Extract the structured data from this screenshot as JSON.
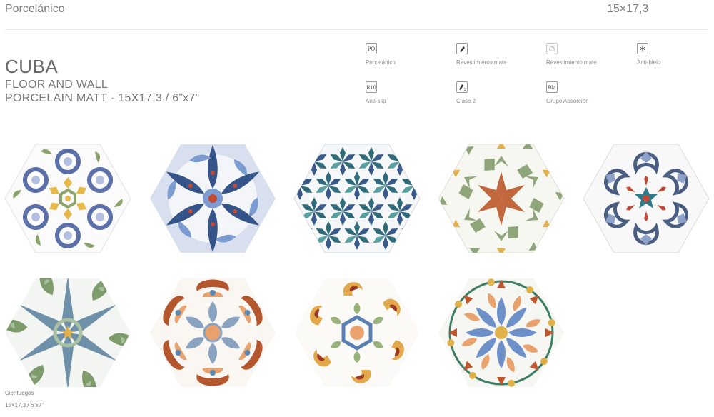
{
  "header": {
    "material": "Porcelánico",
    "size": "15×17,3"
  },
  "product": {
    "title": "CUBA",
    "line1": "FLOOR AND WALL",
    "line2": "PORCELAIN MATT · 15X17,3 / 6”x7”"
  },
  "features": [
    {
      "icon": "PO",
      "label": "Porcelánico"
    },
    {
      "icon": "",
      "label": "Revestimiento mate"
    },
    {
      "icon": "",
      "label": "Revestimiento mate"
    },
    {
      "icon": "",
      "label": "Anti-hielo"
    },
    {
      "icon": "R10",
      "label": "Anti-slip"
    },
    {
      "icon": "2",
      "label": "Clase 2"
    },
    {
      "icon": "Bla",
      "label": "Grupo Absorción"
    }
  ],
  "caption": {
    "name": "Cienfuegos",
    "size": "15×17,3 / 6”x7”"
  },
  "tiles": [
    {
      "pattern": "floral-rosette",
      "colors": [
        "#5b6fa8",
        "#e6b84a",
        "#8aa36a",
        "#b5bfe0"
      ]
    },
    {
      "pattern": "petal-star",
      "colors": [
        "#34548a",
        "#7c9bd1",
        "#c44a33",
        "#d8dfee"
      ]
    },
    {
      "pattern": "star-lattice",
      "colors": [
        "#2f6b78",
        "#3a5a8c",
        "#58a0a0"
      ]
    },
    {
      "pattern": "geometric-star",
      "colors": [
        "#c2683e",
        "#8fa57a",
        "#e3b04a",
        "#cdd9c2"
      ]
    },
    {
      "pattern": "damask-star",
      "colors": [
        "#4a5e82",
        "#8ea2c8",
        "#c04a36",
        "#2f7a8a"
      ]
    },
    {
      "pattern": "leaf-star",
      "colors": [
        "#7e9b6c",
        "#6e90a8",
        "#e0b04a",
        "#a9c0a2"
      ]
    },
    {
      "pattern": "ornament-flower",
      "colors": [
        "#b4562e",
        "#5c86b2",
        "#e9a26e",
        "#8aa3c0"
      ]
    },
    {
      "pattern": "scroll-hex",
      "colors": [
        "#e3a84c",
        "#9c3a26",
        "#5a7fb2",
        "#98b27c"
      ]
    },
    {
      "pattern": "mosaic-flower",
      "colors": [
        "#c0562e",
        "#6e90c8",
        "#e0b04a",
        "#3d7d64"
      ]
    }
  ]
}
